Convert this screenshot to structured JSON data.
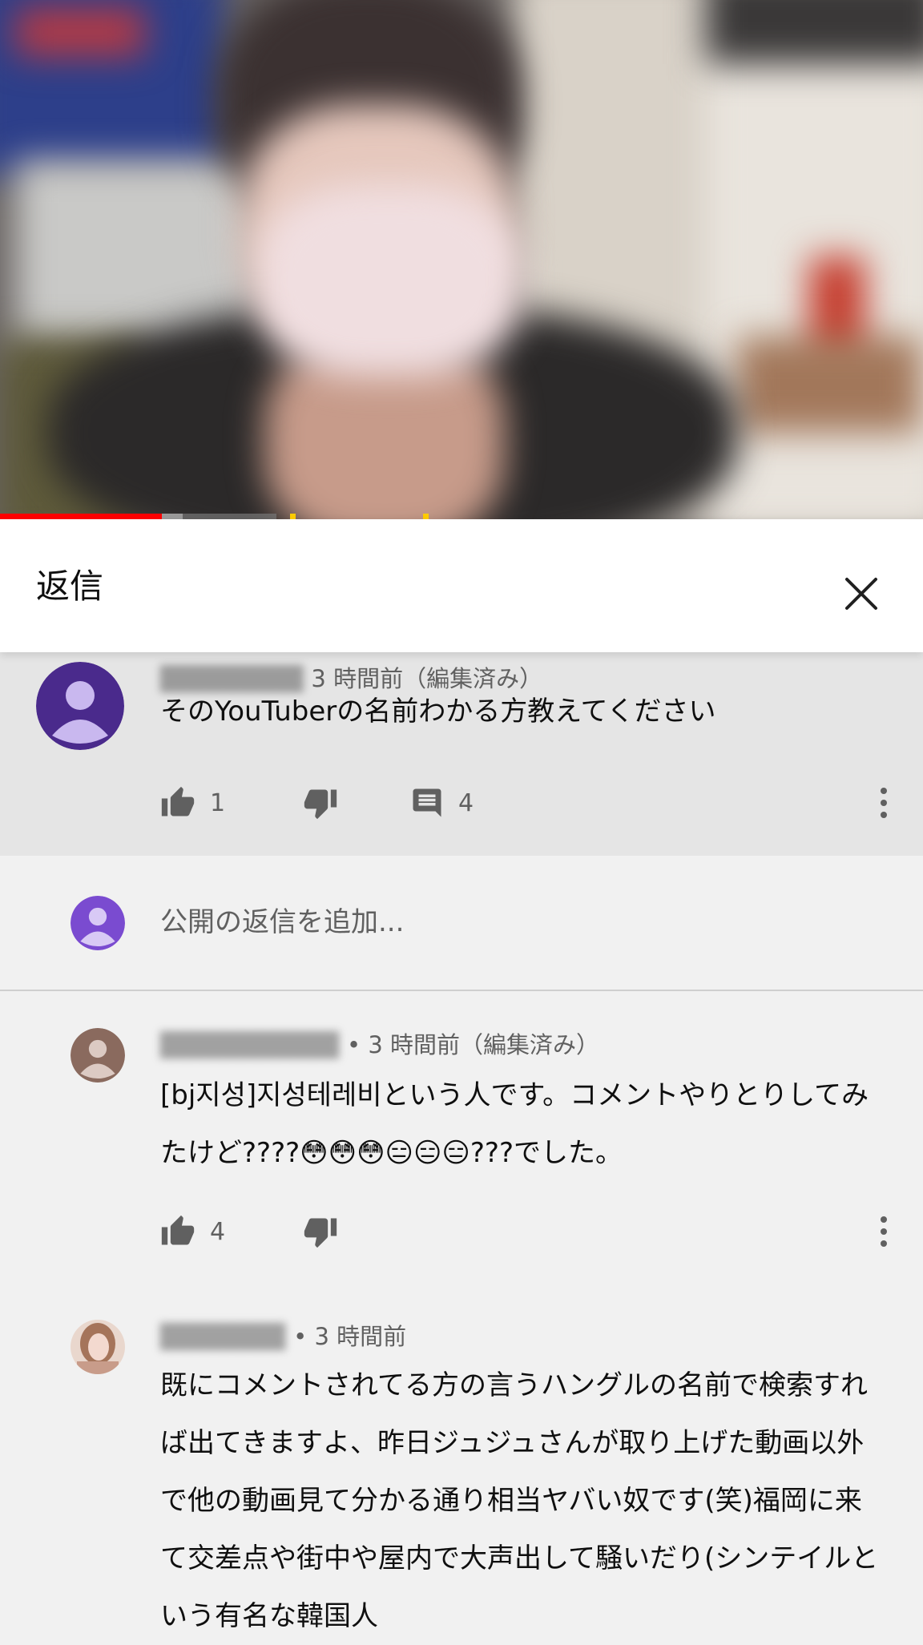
{
  "panel": {
    "title": "返信",
    "close_icon": "close-icon"
  },
  "parent_comment": {
    "time": "3 時間前（編集済み）",
    "text": "そのYouTuberの名前わかる方教えてください",
    "likes": "1",
    "replies": "4",
    "avatar_color": "#4a2a8c"
  },
  "reply_input": {
    "placeholder": "公開の返信を追加..."
  },
  "replies": [
    {
      "time": "• 3 時間前（編集済み）",
      "text": "[bj지성]지성테레비という人です。コメントやりとりしてみたけど????😳😳😳😑😑😑???でした。",
      "likes": "4"
    },
    {
      "time": "• 3 時間前",
      "text": "既にコメントされてる方の言うハングルの名前で検索すれば出てきますよ、昨日ジュジュさんが取り上げた動画以外で他の動画見て分かる通り相当ヤバい奴です(笑)福岡に来て交差点や街中や屋内で大声出して騒いだり(シンテイルという有名な韓国人"
    }
  ],
  "colors": {
    "progress": "#ff0000",
    "accent_text": "#0f0f0f",
    "secondary_text": "#606060"
  }
}
